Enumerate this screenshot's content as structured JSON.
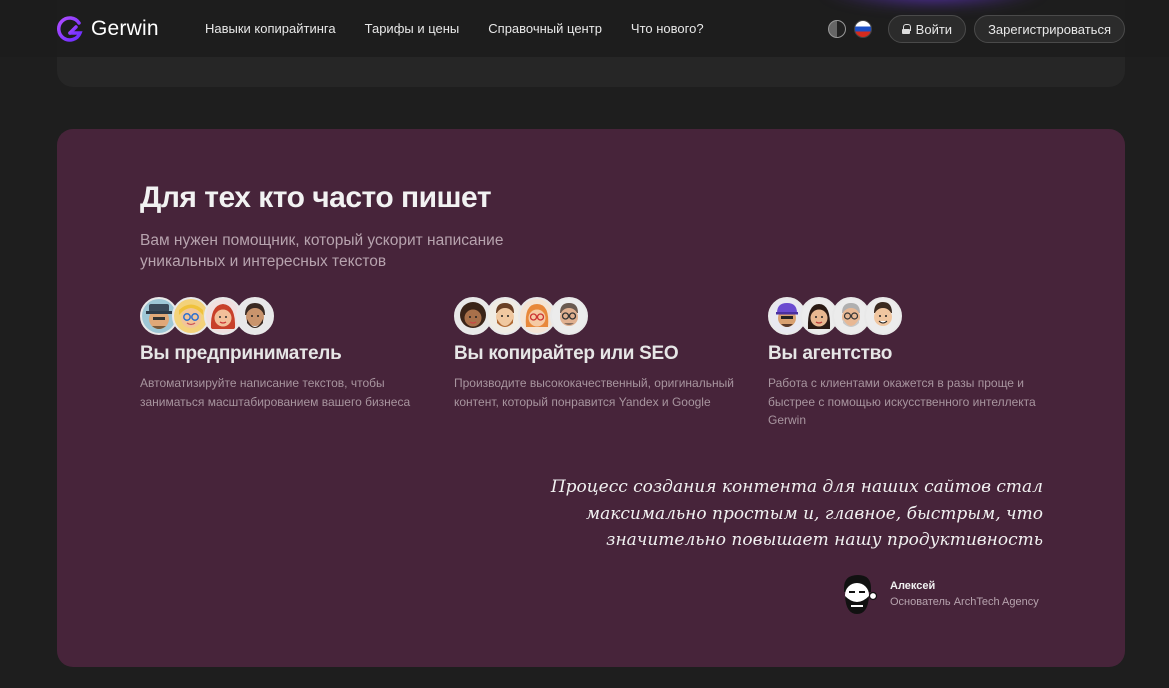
{
  "header": {
    "logo_text": "Gerwin",
    "nav": [
      {
        "label": "Навыки копирайтинга"
      },
      {
        "label": "Тарифы и цены"
      },
      {
        "label": "Справочный центр"
      },
      {
        "label": "Что нового?"
      }
    ],
    "theme_icon": "contrast-icon",
    "language_icon": "russia-flag-icon",
    "login_label": "Войти",
    "register_label": "Зарегистрироваться"
  },
  "section": {
    "title": "Для тех кто часто пишет",
    "subtitle": "Вам нужен помощник, который ускорит написание уникальных и интересных текстов",
    "columns": [
      {
        "title": "Вы предприниматель",
        "text": "Автоматизируйте написание текстов, чтобы заниматься масштабированием вашего бизнеса"
      },
      {
        "title": "Вы копирайтер или SEO",
        "text": "Производите высококачественный, оригинальный контент, который понравится Yandex и Google"
      },
      {
        "title": "Вы агентство",
        "text": "Работа с клиентами окажется в разы проще и быстрее с помощью искусственного интеллекта Gerwin"
      }
    ],
    "quote": "Процесс создания контента для наших сайтов стал максимально простым и, главное, быстрым, что значительно повышает нашу продуктивность",
    "author": {
      "name": "Алексей",
      "role": "Основатель ArchTech Agency"
    }
  },
  "colors": {
    "background": "#1e1e1e",
    "section": "#47243a",
    "accent": "#7b3cff"
  }
}
